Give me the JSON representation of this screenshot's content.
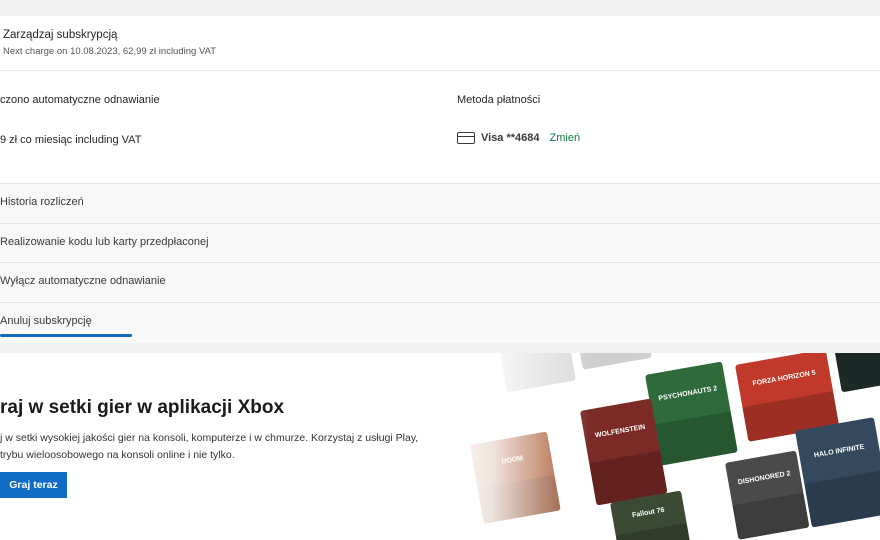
{
  "subscription": {
    "manage_title": "Zarządzaj subskrypcją",
    "next_charge": "Next charge on 10.08.2023, 62,99 zł including VAT"
  },
  "renewal": {
    "label": "czono automatyczne odnawianie",
    "price": "9 zł co miesiąc including VAT"
  },
  "payment": {
    "label": "Metoda płatności",
    "card_icon": "credit-card-icon",
    "card": "Visa **4684",
    "change": "Zmień"
  },
  "links": [
    {
      "label": "Historia rozliczeń"
    },
    {
      "label": "Realizowanie kodu lub karty przedpłaconej"
    },
    {
      "label": "Wyłącz automatyczne odnawianie"
    },
    {
      "label": "Anuluj subskrypcję"
    }
  ],
  "promo": {
    "title": "raj w setki gier w aplikacji Xbox",
    "description": "j w setki wysokiej jakości gier na konsoli, komputerze i w chmurze. Korzystaj z usługi Play, trybu wieloosobowego na konsoli online i nie tylko.",
    "button": "Graj teraz",
    "tiles": [
      {
        "label": "FORZA HORIZON 5",
        "color": "#c0392b"
      },
      {
        "label": "PSYCHONAUTS 2",
        "color": "#2f6b3a"
      },
      {
        "label": "WOLFENSTEIN",
        "color": "#7b2a25"
      },
      {
        "label": "HALO INFINITE",
        "color": "#34495e"
      },
      {
        "label": "DOOM",
        "color": "#a14a1e"
      },
      {
        "label": "DISHONORED 2",
        "color": "#4a4a4a"
      },
      {
        "label": "Fallout 76",
        "color": "#3b4a33"
      }
    ]
  }
}
